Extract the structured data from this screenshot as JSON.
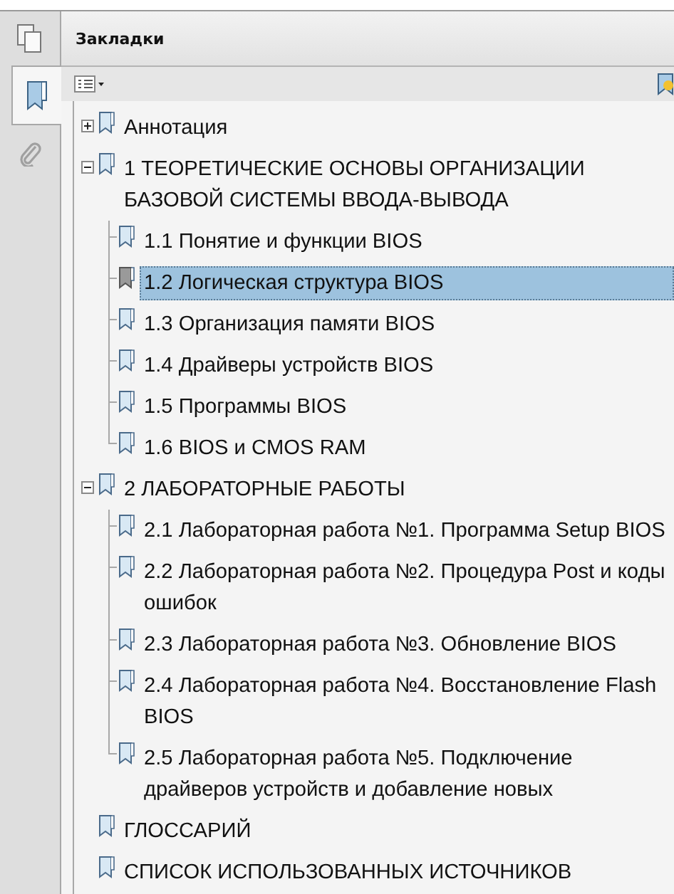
{
  "rail_tabs": [
    {
      "kind": "pages",
      "selected": false
    },
    {
      "kind": "bookmarks",
      "selected": true
    },
    {
      "kind": "attachments",
      "selected": false
    }
  ],
  "panel": {
    "title": "Закладки"
  },
  "bookmarks": [
    {
      "label": "Аннотация",
      "expanded": false,
      "selected": false
    },
    {
      "label": "1 ТЕОРЕТИЧЕСКИЕ ОСНОВЫ ОРГАНИЗАЦИИ БАЗОВОЙ СИСТЕМЫ ВВОДА-ВЫВОДА",
      "expanded": true,
      "selected": false,
      "children": [
        {
          "label": "1.1 Понятие и функции BIOS",
          "selected": false
        },
        {
          "label": "1.2 Логическая структура BIOS",
          "selected": true
        },
        {
          "label": "1.3 Организация памяти BIOS",
          "selected": false
        },
        {
          "label": "1.4 Драйверы устройств BIOS",
          "selected": false
        },
        {
          "label": "1.5 Программы BIOS",
          "selected": false
        },
        {
          "label": "1.6 BIOS и CMOS RAM",
          "selected": false
        }
      ]
    },
    {
      "label": "2 ЛАБОРАТОРНЫЕ РАБОТЫ",
      "expanded": true,
      "selected": false,
      "children": [
        {
          "label": "2.1 Лабораторная работа №1. Программа Setup BIOS",
          "selected": false
        },
        {
          "label": "2.2 Лабораторная работа №2. Процедура Post и коды ошибок",
          "selected": false
        },
        {
          "label": "2.3 Лабораторная работа №3. Обновление BIOS",
          "selected": false
        },
        {
          "label": "2.4 Лабораторная работа №4. Восстановление Flash BIOS",
          "selected": false
        },
        {
          "label": "2.5 Лабораторная работа №5. Подключение драйверов устройств и добавление новых",
          "selected": false
        }
      ]
    },
    {
      "label": "ГЛОССАРИЙ",
      "selected": false
    },
    {
      "label": "СПИСОК ИСПОЛЬЗОВАННЫХ ИСТОЧНИКОВ",
      "selected": false
    }
  ]
}
